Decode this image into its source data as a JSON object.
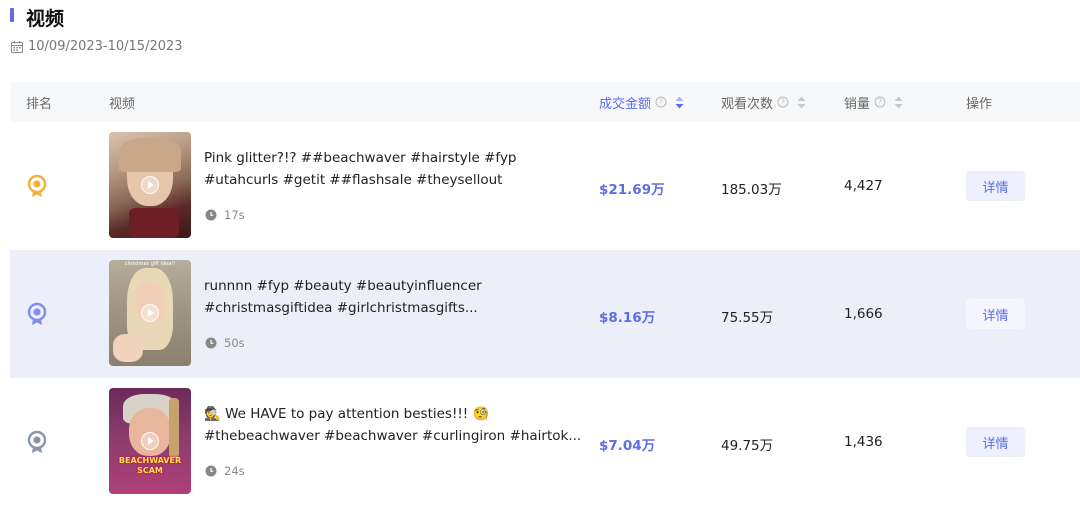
{
  "section": {
    "title": "视频",
    "date_range": "10/09/2023-10/15/2023"
  },
  "table": {
    "headers": {
      "rank": "排名",
      "video": "视频",
      "amount": "成交金额",
      "views": "观看次数",
      "sales": "销量",
      "action": "操作"
    },
    "sorted_column": "amount",
    "rows": [
      {
        "rank_icon": "gold-medal-icon",
        "title": "Pink glitter?!? ##beachwaver #hairstyle #fyp #utahcurls #getit ##flashsale #theysellout",
        "duration": "17s",
        "amount": "$21.69万",
        "views": "185.03万",
        "sales": "4,427",
        "action": "详情",
        "highlighted": false
      },
      {
        "rank_icon": "silver-medal-icon",
        "title": "runnnn #fyp #beauty #beautyinfluencer #christmasgiftidea #girlchristmasgifts...",
        "duration": "50s",
        "thumb_caption": "christmas gift idea!!",
        "amount": "$8.16万",
        "views": "75.55万",
        "sales": "1,666",
        "action": "详情",
        "highlighted": true
      },
      {
        "rank_icon": "bronze-medal-icon",
        "title": "🕵 We HAVE to pay attention besties!!! 🧐 #thebeachwaver #beachwaver #curlingiron #hairtok...",
        "duration": "24s",
        "thumb_caption": "BEACHWAVER SCAM",
        "amount": "$7.04万",
        "views": "49.75万",
        "sales": "1,436",
        "action": "详情",
        "highlighted": false
      }
    ]
  },
  "colors": {
    "accent": "#5a6ee8",
    "highlight_row": "#eceefa",
    "gold": "#f2b13c",
    "silver": "#7f8fe6",
    "bronze": "#8a94aa"
  }
}
